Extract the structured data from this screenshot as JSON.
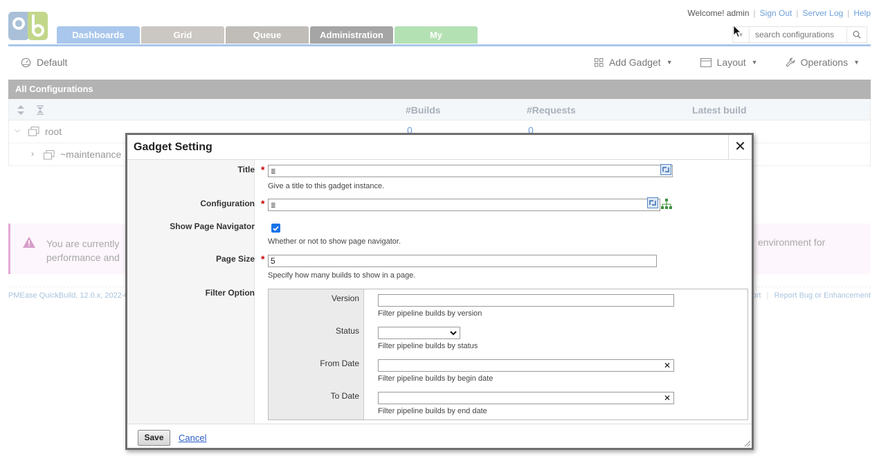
{
  "header": {
    "tabs": [
      {
        "label": "Dashboards"
      },
      {
        "label": "Grid"
      },
      {
        "label": "Queue"
      },
      {
        "label": "Administration"
      },
      {
        "label": "My"
      }
    ],
    "welcome": "Welcome! admin",
    "links": {
      "signout": "Sign Out",
      "serverlog": "Server Log",
      "help": "Help"
    },
    "search_placeholder": "search configurations"
  },
  "toolbar": {
    "dashboard_name": "Default",
    "add_gadget": "Add Gadget",
    "layout": "Layout",
    "operations": "Operations"
  },
  "configurations": {
    "title": "All Configurations",
    "columns": {
      "builds": "#Builds",
      "requests": "#Requests",
      "latest": "Latest build"
    },
    "rows": [
      {
        "name": "root",
        "builds": "0",
        "requests": "0"
      },
      {
        "name": "~maintenance"
      }
    ]
  },
  "alert": {
    "message_start": "You are currently",
    "message_line2": "performance and",
    "message_end": "environment for"
  },
  "footer": {
    "left": "PMEase QuickBuild, 12.0.x, 2022-0",
    "right_partial": "port",
    "report_bug": "Report Bug or Enhancement"
  },
  "dialog": {
    "title": "Gadget Setting",
    "fields": {
      "title": {
        "label": "Title",
        "value": "",
        "help": "Give a title to this gadget instance."
      },
      "configuration": {
        "label": "Configuration",
        "value": ""
      },
      "show_navigator": {
        "label": "Show Page Navigator",
        "checked": true,
        "help": "Whether or not to show page navigator."
      },
      "page_size": {
        "label": "Page Size",
        "value": "5",
        "help": "Specify how many builds to show in a page."
      },
      "filter_option": {
        "label": "Filter Option"
      }
    },
    "filter": {
      "version": {
        "label": "Version",
        "help": "Filter pipeline builds by version"
      },
      "status": {
        "label": "Status",
        "help": "Filter pipeline builds by status"
      },
      "from_date": {
        "label": "From Date",
        "help": "Filter pipeline builds by begin date"
      },
      "to_date": {
        "label": "To Date",
        "help": "Filter pipeline builds by end date"
      }
    },
    "buttons": {
      "save": "Save",
      "cancel": "Cancel"
    }
  },
  "colors": {
    "tab_dashboards": "#a9c7ec",
    "tab_my": "#b4e1b4",
    "link": "#6ea0d8",
    "required": "#cc0000"
  }
}
